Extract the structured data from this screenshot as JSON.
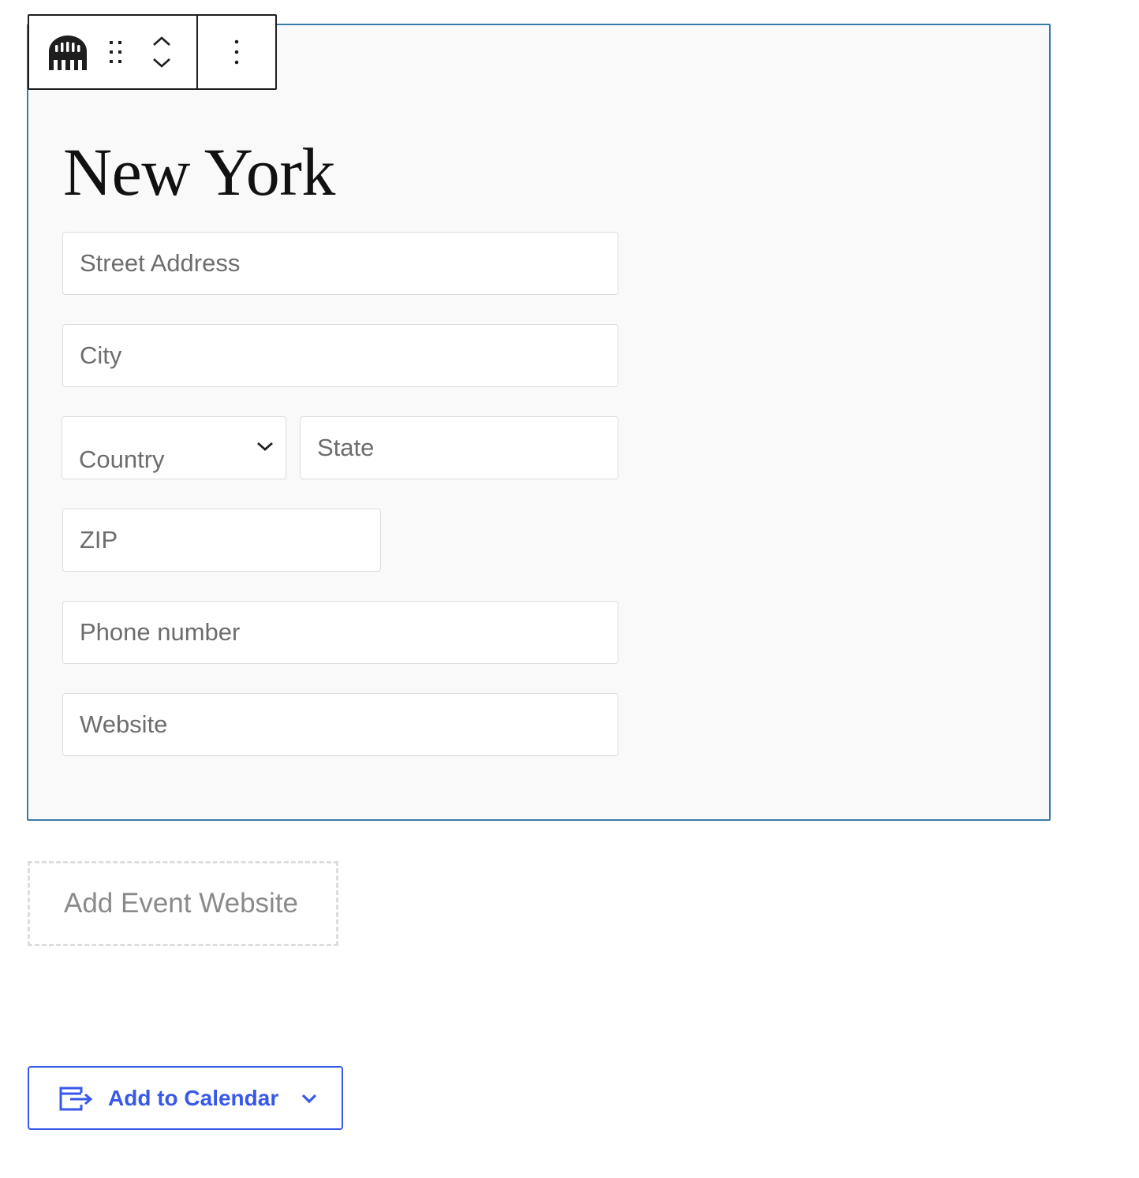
{
  "toolbar": {
    "block_icon": "venue-building-icon",
    "drag_icon": "drag-handle-icon",
    "move_up_icon": "chevron-up-icon",
    "move_down_icon": "chevron-down-icon",
    "options_icon": "more-vertical-icon"
  },
  "venue": {
    "title": "New York",
    "street_placeholder": "Street Address",
    "city_placeholder": "City",
    "country_selected": "Country",
    "state_placeholder": "State",
    "zip_placeholder": "ZIP",
    "phone_placeholder": "Phone number",
    "website_placeholder": "Website"
  },
  "event_website": {
    "placeholder": "Add Event Website"
  },
  "calendar": {
    "label": "Add to Calendar",
    "icon": "calendar-export-icon",
    "chevron_icon": "chevron-down-icon"
  },
  "colors": {
    "block_border": "#3a7ba6",
    "block_background": "#f9f9f9",
    "accent": "#3858e9",
    "toolbar_border": "#1e1e1e"
  }
}
